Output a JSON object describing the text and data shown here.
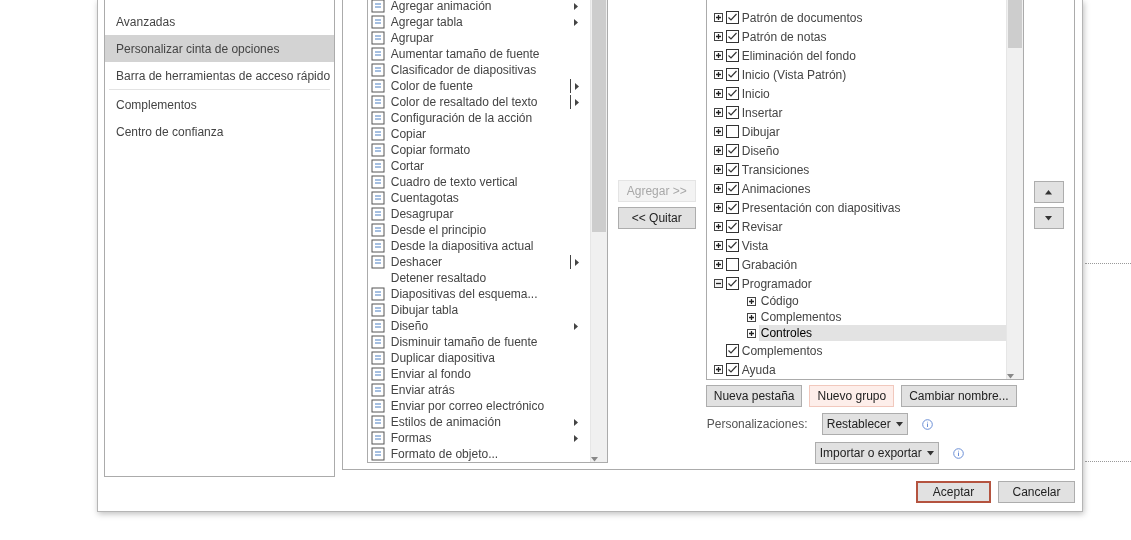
{
  "nav_groups": [
    [
      {
        "label": "Avanzadas",
        "selected": false
      },
      {
        "label": "Personalizar cinta de opciones",
        "selected": true
      },
      {
        "label": "Barra de herramientas de acceso rápido",
        "selected": false
      }
    ],
    [
      {
        "label": "Complementos",
        "selected": false
      },
      {
        "label": "Centro de confianza",
        "selected": false
      }
    ]
  ],
  "commands": [
    {
      "label": "Agregar animación",
      "icon": true,
      "kind": "menu"
    },
    {
      "label": "Agregar tabla",
      "icon": true,
      "kind": "menu"
    },
    {
      "label": "Agrupar",
      "icon": true,
      "kind": "plain"
    },
    {
      "label": "Aumentar tamaño de fuente",
      "icon": true,
      "kind": "plain"
    },
    {
      "label": "Clasificador de diapositivas",
      "icon": true,
      "kind": "plain"
    },
    {
      "label": "Color de fuente",
      "icon": true,
      "kind": "split"
    },
    {
      "label": "Color de resaltado del texto",
      "icon": true,
      "kind": "split"
    },
    {
      "label": "Configuración de la acción",
      "icon": true,
      "kind": "plain"
    },
    {
      "label": "Copiar",
      "icon": true,
      "kind": "plain"
    },
    {
      "label": "Copiar formato",
      "icon": true,
      "kind": "plain"
    },
    {
      "label": "Cortar",
      "icon": true,
      "kind": "plain"
    },
    {
      "label": "Cuadro de texto vertical",
      "icon": true,
      "kind": "plain"
    },
    {
      "label": "Cuentagotas",
      "icon": true,
      "kind": "plain"
    },
    {
      "label": "Desagrupar",
      "icon": true,
      "kind": "plain"
    },
    {
      "label": "Desde el principio",
      "icon": true,
      "kind": "plain"
    },
    {
      "label": "Desde la diapositiva actual",
      "icon": true,
      "kind": "plain"
    },
    {
      "label": "Deshacer",
      "icon": true,
      "kind": "split"
    },
    {
      "label": "Detener resaltado",
      "icon": false,
      "kind": "plain"
    },
    {
      "label": "Diapositivas del esquema...",
      "icon": true,
      "kind": "plain"
    },
    {
      "label": "Dibujar tabla",
      "icon": true,
      "kind": "plain"
    },
    {
      "label": "Diseño",
      "icon": true,
      "kind": "menu"
    },
    {
      "label": "Disminuir tamaño de fuente",
      "icon": true,
      "kind": "plain"
    },
    {
      "label": "Duplicar diapositiva",
      "icon": true,
      "kind": "plain"
    },
    {
      "label": "Enviar al fondo",
      "icon": true,
      "kind": "plain"
    },
    {
      "label": "Enviar atrás",
      "icon": true,
      "kind": "plain"
    },
    {
      "label": "Enviar por correo electrónico",
      "icon": true,
      "kind": "plain"
    },
    {
      "label": "Estilos de animación",
      "icon": true,
      "kind": "menu"
    },
    {
      "label": "Formas",
      "icon": true,
      "kind": "menu"
    },
    {
      "label": "Formato de objeto...",
      "icon": true,
      "kind": "plain"
    }
  ],
  "add_button": {
    "label": "Agregar >>",
    "disabled": true
  },
  "remove_button": {
    "label": "<< Quitar",
    "disabled": false
  },
  "tabs_tree": [
    {
      "label": "Patrón de documentos",
      "checked": true,
      "expandable": true,
      "expanded": false
    },
    {
      "label": "Patrón de notas",
      "checked": true,
      "expandable": true,
      "expanded": false
    },
    {
      "label": "Eliminación del fondo",
      "checked": true,
      "expandable": true,
      "expanded": false
    },
    {
      "label": "Inicio (Vista Patrón)",
      "checked": true,
      "expandable": true,
      "expanded": false
    },
    {
      "label": "Inicio",
      "checked": true,
      "expandable": true,
      "expanded": false
    },
    {
      "label": "Insertar",
      "checked": true,
      "expandable": true,
      "expanded": false
    },
    {
      "label": "Dibujar",
      "checked": false,
      "expandable": true,
      "expanded": false
    },
    {
      "label": "Diseño",
      "checked": true,
      "expandable": true,
      "expanded": false
    },
    {
      "label": "Transiciones",
      "checked": true,
      "expandable": true,
      "expanded": false
    },
    {
      "label": "Animaciones",
      "checked": true,
      "expandable": true,
      "expanded": false
    },
    {
      "label": "Presentación con diapositivas",
      "checked": true,
      "expandable": true,
      "expanded": false
    },
    {
      "label": "Revisar",
      "checked": true,
      "expandable": true,
      "expanded": false
    },
    {
      "label": "Vista",
      "checked": true,
      "expandable": true,
      "expanded": false
    },
    {
      "label": "Grabación",
      "checked": false,
      "expandable": true,
      "expanded": false
    },
    {
      "label": "Programador",
      "checked": true,
      "expandable": true,
      "expanded": true,
      "children": [
        {
          "label": "Código",
          "selected": false
        },
        {
          "label": "Complementos",
          "selected": false
        },
        {
          "label": "Controles",
          "selected": true
        }
      ]
    },
    {
      "label": "Complementos",
      "checked": true,
      "expandable": false,
      "expanded": false
    },
    {
      "label": "Ayuda",
      "checked": true,
      "expandable": true,
      "expanded": false
    }
  ],
  "tree_buttons": [
    {
      "label": "Nueva pestaña",
      "focused": false
    },
    {
      "label": "Nuevo grupo",
      "focused": true
    },
    {
      "label": "Cambiar nombre...",
      "focused": false
    }
  ],
  "customizations": {
    "label": "Personalizaciones:",
    "reset": "Restablecer",
    "import_export": "Importar o exportar"
  },
  "footer_buttons": [
    {
      "label": "Aceptar",
      "default": true
    },
    {
      "label": "Cancelar",
      "default": false
    }
  ]
}
